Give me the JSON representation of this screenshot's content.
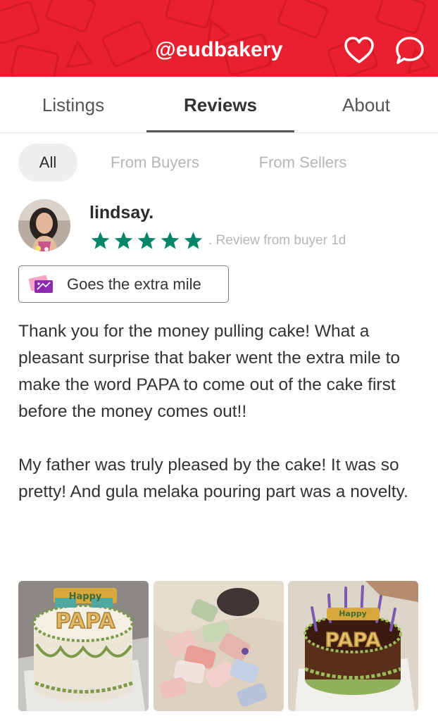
{
  "header": {
    "title": "@eudbakery",
    "brand_color": "#e8202f",
    "icons": [
      "heart-icon",
      "chat-bubble-icon"
    ]
  },
  "tabs": [
    {
      "label": "Listings",
      "active": false
    },
    {
      "label": "Reviews",
      "active": true
    },
    {
      "label": "About",
      "active": false
    }
  ],
  "filters": [
    {
      "label": "All",
      "selected": true
    },
    {
      "label": "From Buyers",
      "selected": false
    },
    {
      "label": "From Sellers",
      "selected": false
    }
  ],
  "review": {
    "reviewer": "lindsay.",
    "rating": 5,
    "star_color": "#05866b",
    "meta": ". Review from buyer 1d",
    "badge": "Goes the extra mile",
    "paragraphs": [
      "Thank you for the money pulling cake! What a pleasant surprise that baker went the extra mile to make the word PAPA to come out of the cake first before the money comes out!!",
      "My father was truly pleased by the cake! It was so pretty! And gula melaka pouring part was a novelty."
    ],
    "photos": [
      {
        "cake_text": "PAPA",
        "topper_text": "Happy"
      },
      {
        "cake_text": ""
      },
      {
        "cake_text": "PAPA",
        "topper_text": "Happy"
      }
    ]
  }
}
